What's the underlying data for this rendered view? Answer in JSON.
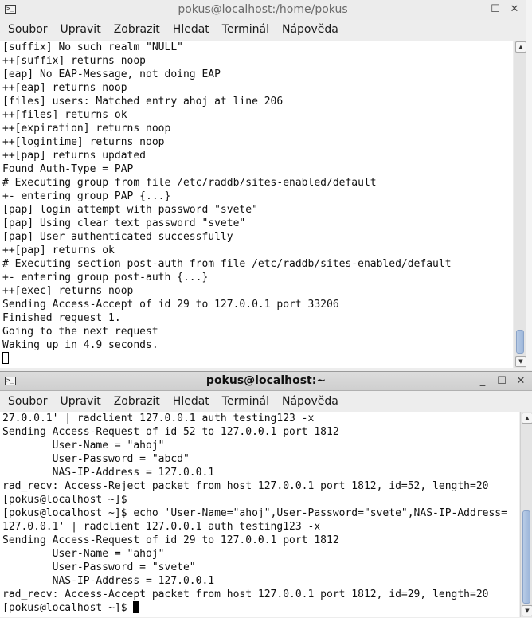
{
  "colors": {
    "scroll_thumb": "#9db6da",
    "terminal_bg": "#ffffff",
    "text": "#111111"
  },
  "window_top": {
    "title": "pokus@localhost:/home/pokus",
    "menu": [
      "Soubor",
      "Upravit",
      "Zobrazit",
      "Hledat",
      "Terminál",
      "Nápověda"
    ],
    "lines": [
      "[suffix] No such realm \"NULL\"",
      "++[suffix] returns noop",
      "[eap] No EAP-Message, not doing EAP",
      "++[eap] returns noop",
      "[files] users: Matched entry ahoj at line 206",
      "++[files] returns ok",
      "++[expiration] returns noop",
      "++[logintime] returns noop",
      "++[pap] returns updated",
      "Found Auth-Type = PAP",
      "# Executing group from file /etc/raddb/sites-enabled/default",
      "+- entering group PAP {...}",
      "[pap] login attempt with password \"svete\"",
      "[pap] Using clear text password \"svete\"",
      "[pap] User authenticated successfully",
      "++[pap] returns ok",
      "# Executing section post-auth from file /etc/raddb/sites-enabled/default",
      "+- entering group post-auth {...}",
      "++[exec] returns noop",
      "Sending Access-Accept of id 29 to 127.0.0.1 port 33206",
      "Finished request 1.",
      "Going to the next request",
      "Waking up in 4.9 seconds."
    ],
    "window_buttons": {
      "minimize": "_",
      "maximize": "☐",
      "close": "✕"
    },
    "scroll_position_fraction": 0.97
  },
  "window_bottom": {
    "title": "pokus@localhost:~",
    "menu": [
      "Soubor",
      "Upravit",
      "Zobrazit",
      "Hledat",
      "Terminál",
      "Nápověda"
    ],
    "lines": [
      "27.0.0.1' | radclient 127.0.0.1 auth testing123 -x",
      "Sending Access-Request of id 52 to 127.0.0.1 port 1812",
      "        User-Name = \"ahoj\"",
      "        User-Password = \"abcd\"",
      "        NAS-IP-Address = 127.0.0.1",
      "rad_recv: Access-Reject packet from host 127.0.0.1 port 1812, id=52, length=20",
      "[pokus@localhost ~]$",
      "[pokus@localhost ~]$ echo 'User-Name=\"ahoj\",User-Password=\"svete\",NAS-IP-Address=",
      "127.0.0.1' | radclient 127.0.0.1 auth testing123 -x",
      "Sending Access-Request of id 29 to 127.0.0.1 port 1812",
      "        User-Name = \"ahoj\"",
      "        User-Password = \"svete\"",
      "        NAS-IP-Address = 127.0.0.1",
      "rad_recv: Access-Accept packet from host 127.0.0.1 port 1812, id=29, length=20"
    ],
    "prompt": "[pokus@localhost ~]$ ",
    "window_buttons": {
      "minimize": "_",
      "maximize": "☐",
      "close": "✕"
    },
    "scroll_position_fraction": 0.95
  }
}
